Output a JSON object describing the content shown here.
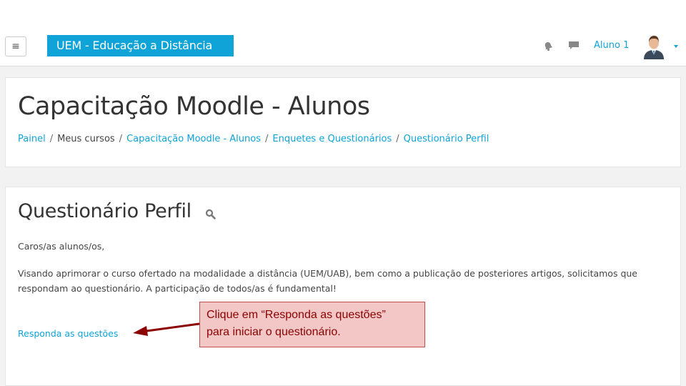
{
  "navbar": {
    "menu_icon": "hamburger-icon",
    "brand": "UEM - Educação a Distância",
    "notification_icon": "bell-icon",
    "messages_icon": "chat-icon",
    "user_name": "Aluno 1",
    "avatar_icon": "user-avatar-icon",
    "accent_color": "#0fa3d8"
  },
  "header": {
    "title": "Capacitação Moodle - Alunos",
    "breadcrumb": [
      "Painel",
      "Meus cursos",
      "Capacitação Moodle - Alunos",
      "Enquetes e Questionários",
      "Questionário Perfil"
    ]
  },
  "activity": {
    "title": "Questionário Perfil",
    "greeting": "Caros/as alunos/os,",
    "description": "Visando aprimorar o curso ofertado na modalidade a distância (UEM/UAB), bem como a publicação de posteriores artigos, solicitamos que  respondam ao questionário. A participação de todos/as é fundamental!",
    "link": "Responda as questões"
  },
  "callout": {
    "line1": "Clique em “Responda as questões”",
    "line2": "para iniciar o questionário."
  }
}
